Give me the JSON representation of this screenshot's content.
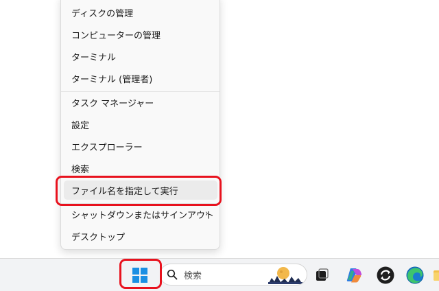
{
  "context_menu": {
    "items": [
      {
        "label": "ディスクの管理"
      },
      {
        "label": "コンピューターの管理"
      },
      {
        "label": "ターミナル"
      },
      {
        "label": "ターミナル (管理者)"
      },
      {
        "label": "タスク マネージャー"
      },
      {
        "label": "設定"
      },
      {
        "label": "エクスプローラー"
      },
      {
        "label": "検索"
      },
      {
        "label": "ファイル名を指定して実行"
      },
      {
        "label": "シャットダウンまたはサインアウト",
        "submenu_arrow": "›"
      },
      {
        "label": "デスクトップ"
      }
    ]
  },
  "taskbar": {
    "start_icon": "windows-logo",
    "search": {
      "icon": "search-icon",
      "placeholder": "検索"
    },
    "apps": [
      "task-view-icon",
      "copilot-icon",
      "sync-icon",
      "edge-icon"
    ]
  },
  "colors": {
    "highlight": "#e8121e",
    "menu_background": "#f9f9f9",
    "hover_background": "#ebebeb",
    "taskbar_background": "#f2f3f5",
    "windows_blue": "#1a8fe3"
  }
}
